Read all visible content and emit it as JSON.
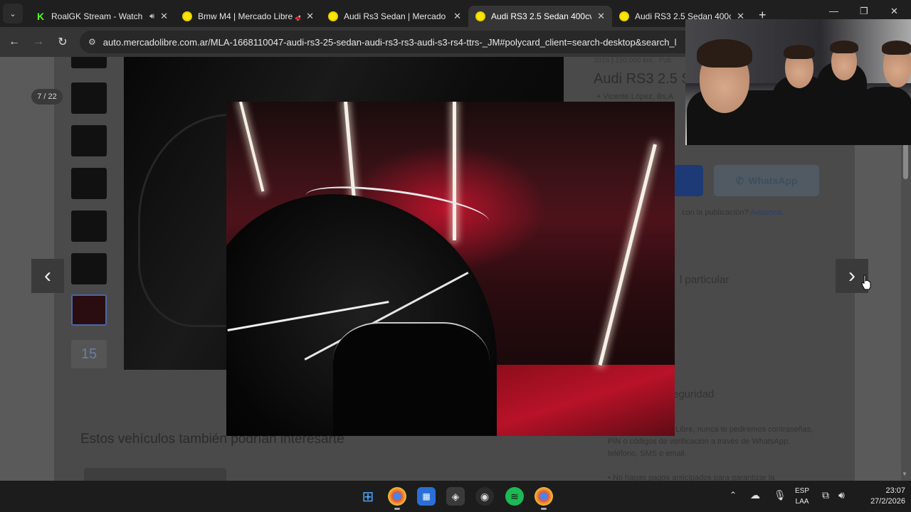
{
  "browser": {
    "tabs": [
      {
        "title": "RoalGK Stream - Watch",
        "favicon": "kick-icon",
        "audio": true
      },
      {
        "title": "Bmw M4 | Mercado Libre 🚗",
        "favicon": "mercadolibre-icon"
      },
      {
        "title": "Audi Rs3 Sedan | Mercado L",
        "favicon": "mercadolibre-icon"
      },
      {
        "title": "Audi RS3 2.5 Sedan 400cv | ",
        "favicon": "mercadolibre-icon",
        "active": true
      },
      {
        "title": "Audi RS3 2.5 Sedan 400cv | ",
        "favicon": "mercadolibre-icon"
      }
    ],
    "url": "auto.mercadolibre.com.ar/MLA-1668110047-audi-rs3-25-sedan-audi-rs3-rs3-audi-s3-rs4-ttrs-_JM#polycard_client=search-desktop&search_l"
  },
  "gallery": {
    "counter": "7 / 22",
    "more_count": "15"
  },
  "listing": {
    "meta": "2016 | 150.000 km · Pub",
    "title": "Audi RS3 2.5 S",
    "location": "Vicente López, Bs.A",
    "whatsapp_label": "WhatsApp",
    "report_text": "con la publicación?",
    "report_link": "Avisanos.",
    "seller_type": "l particular",
    "security_heading": "eguridad",
    "security_text": "Libre, nunca te pediremos contraseñas, PIN o códigos de verificación a través de WhatsApp, teléfono, SMS o email.",
    "security_bullet": "No hagas pagos anticipados para garantizar la",
    "related_heading": "Estos vehículos también podrían interesarte"
  },
  "taskbar": {
    "lang_line1": "ESP",
    "lang_line2": "LAA",
    "time": "23:07",
    "date": "27/2/2026"
  },
  "colors": {
    "accent_blue": "#1d3a77",
    "mercadolibre_yellow": "#ffe600",
    "kick_green": "#53fc18"
  }
}
